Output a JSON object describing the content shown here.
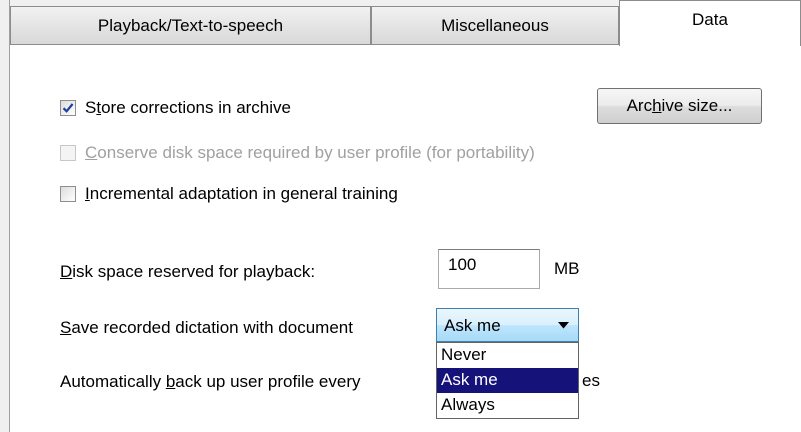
{
  "tabs": [
    {
      "label": "Playback/Text-to-speech",
      "active": false
    },
    {
      "label": "Miscellaneous",
      "active": false
    },
    {
      "label": "Data",
      "active": true
    }
  ],
  "checkboxes": {
    "store_corrections": {
      "label_pre": "S",
      "label_ul": "t",
      "label_post": "ore corrections in archive",
      "checked": true,
      "enabled": true
    },
    "conserve_disk": {
      "label_pre": "",
      "label_ul": "C",
      "label_post": "onserve disk space required by user profile (for portability)",
      "checked": false,
      "enabled": false
    },
    "incremental": {
      "label_pre": "",
      "label_ul": "I",
      "label_post": "ncremental adaptation in general training",
      "checked": false,
      "enabled": true
    }
  },
  "archive_button": {
    "label_pre": "Arc",
    "label_ul": "h",
    "label_post": "ive size..."
  },
  "disk_space": {
    "label_pre": "",
    "label_ul": "D",
    "label_post": "isk space reserved for playback:",
    "value": "100",
    "unit": "MB"
  },
  "save_dictation": {
    "label_pre": "",
    "label_ul": "S",
    "label_post": "ave recorded dictation with document",
    "selected": "Ask me",
    "options": [
      "Never",
      "Ask me",
      "Always"
    ]
  },
  "backup": {
    "label_pre": "Automatically ",
    "label_ul": "b",
    "label_post": "ack up user profile every",
    "tail_text": "es"
  },
  "colors": {
    "selection": "#15127a",
    "combo_border": "#3c7fb1"
  }
}
